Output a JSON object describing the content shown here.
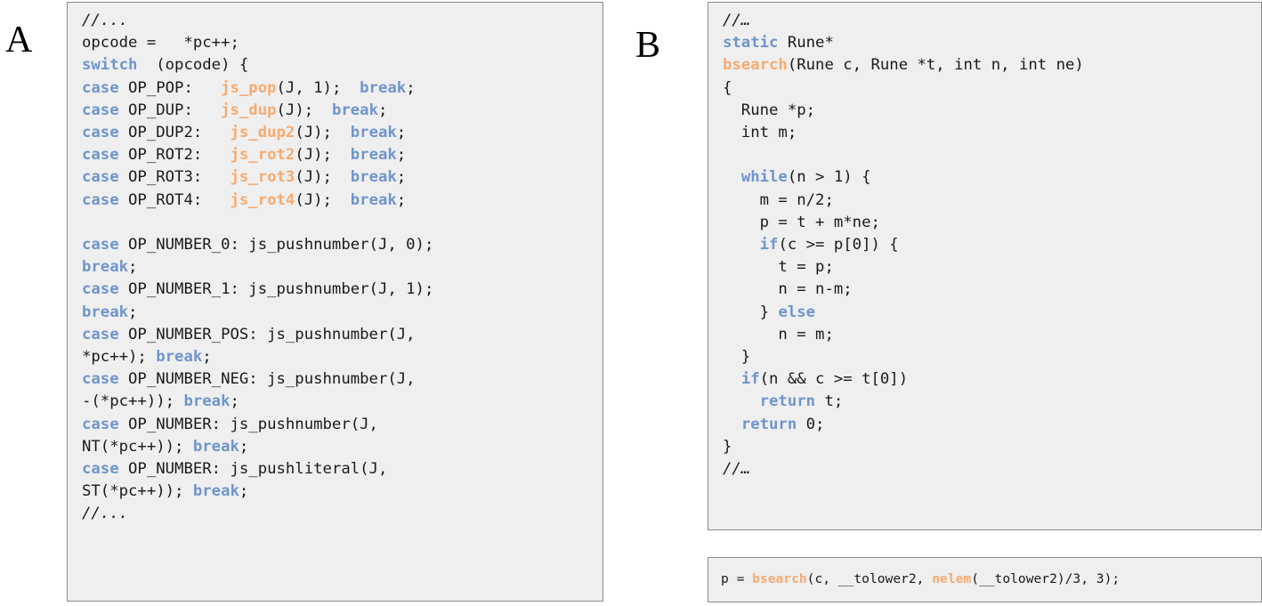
{
  "figure": {
    "background_color": "#ffffff",
    "panel_labels": [
      {
        "name": "A",
        "text": "A"
      },
      {
        "name": "B",
        "text": "B"
      }
    ]
  },
  "colors": {
    "keyword": "#6f95cd",
    "function": "#f7ab70",
    "plain": "#1a1a1a",
    "box_background": "#efefef",
    "box_border": "#8a8a8a",
    "page_background": "#ffffff"
  },
  "panel_a": {
    "label": "A",
    "language": "c",
    "code_text": "//...\nopcode =   *pc++;\nswitch  (opcode) {\ncase OP_POP:   js_pop(J, 1);  break;\ncase OP_DUP:   js_dup(J);  break;\ncase OP_DUP2:   js_dup2(J);  break;\ncase OP_ROT2:   js_rot2(J);  break;\ncase OP_ROT3:   js_rot3(J);  break;\ncase OP_ROT4:   js_rot4(J);  break;\n\ncase OP_NUMBER_0: js_pushnumber(J, 0);\nbreak;\ncase OP_NUMBER_1: js_pushnumber(J, 1);\nbreak;\ncase OP_NUMBER_POS: js_pushnumber(J,\n*pc++); break;\ncase OP_NUMBER_NEG: js_pushnumber(J,\n-(*pc++)); break;\ncase OP_NUMBER: js_pushnumber(J,\nNT(*pc++)); break;\ncase OP_NUMBER: js_pushliteral(J,\nST(*pc++)); break;\n//...",
    "lines": [
      [
        {
          "t": "//...",
          "c": "cm"
        }
      ],
      [
        {
          "t": "opcode =   *pc++;",
          "c": "pl"
        }
      ],
      [
        {
          "t": "switch",
          "c": "kw"
        },
        {
          "t": "  (opcode) {",
          "c": "pl"
        }
      ],
      [
        {
          "t": "case",
          "c": "kw"
        },
        {
          "t": " OP_POP:   ",
          "c": "pl"
        },
        {
          "t": "js_pop",
          "c": "fn"
        },
        {
          "t": "(J, 1);  ",
          "c": "pl"
        },
        {
          "t": "break",
          "c": "kw"
        },
        {
          "t": ";",
          "c": "pl"
        }
      ],
      [
        {
          "t": "case",
          "c": "kw"
        },
        {
          "t": " OP_DUP:   ",
          "c": "pl"
        },
        {
          "t": "js_dup",
          "c": "fn"
        },
        {
          "t": "(J);  ",
          "c": "pl"
        },
        {
          "t": "break",
          "c": "kw"
        },
        {
          "t": ";",
          "c": "pl"
        }
      ],
      [
        {
          "t": "case",
          "c": "kw"
        },
        {
          "t": " OP_DUP2:   ",
          "c": "pl"
        },
        {
          "t": "js_dup2",
          "c": "fn"
        },
        {
          "t": "(J);  ",
          "c": "pl"
        },
        {
          "t": "break",
          "c": "kw"
        },
        {
          "t": ";",
          "c": "pl"
        }
      ],
      [
        {
          "t": "case",
          "c": "kw"
        },
        {
          "t": " OP_ROT2:   ",
          "c": "pl"
        },
        {
          "t": "js_rot2",
          "c": "fn"
        },
        {
          "t": "(J);  ",
          "c": "pl"
        },
        {
          "t": "break",
          "c": "kw"
        },
        {
          "t": ";",
          "c": "pl"
        }
      ],
      [
        {
          "t": "case",
          "c": "kw"
        },
        {
          "t": " OP_ROT3:   ",
          "c": "pl"
        },
        {
          "t": "js_rot3",
          "c": "fn"
        },
        {
          "t": "(J);  ",
          "c": "pl"
        },
        {
          "t": "break",
          "c": "kw"
        },
        {
          "t": ";",
          "c": "pl"
        }
      ],
      [
        {
          "t": "case",
          "c": "kw"
        },
        {
          "t": " OP_ROT4:   ",
          "c": "pl"
        },
        {
          "t": "js_rot4",
          "c": "fn"
        },
        {
          "t": "(J);  ",
          "c": "pl"
        },
        {
          "t": "break",
          "c": "kw"
        },
        {
          "t": ";",
          "c": "pl"
        }
      ],
      [],
      [
        {
          "t": "case",
          "c": "kw"
        },
        {
          "t": " OP_NUMBER_0: js_pushnumber(J, 0);",
          "c": "pl"
        }
      ],
      [
        {
          "t": "break",
          "c": "kw"
        },
        {
          "t": ";",
          "c": "pl"
        }
      ],
      [
        {
          "t": "case",
          "c": "kw"
        },
        {
          "t": " OP_NUMBER_1: js_pushnumber(J, 1);",
          "c": "pl"
        }
      ],
      [
        {
          "t": "break",
          "c": "kw"
        },
        {
          "t": ";",
          "c": "pl"
        }
      ],
      [
        {
          "t": "case",
          "c": "kw"
        },
        {
          "t": " OP_NUMBER_POS: js_pushnumber(J,",
          "c": "pl"
        }
      ],
      [
        {
          "t": "*pc++); ",
          "c": "pl"
        },
        {
          "t": "break",
          "c": "kw"
        },
        {
          "t": ";",
          "c": "pl"
        }
      ],
      [
        {
          "t": "case",
          "c": "kw"
        },
        {
          "t": " OP_NUMBER_NEG: js_pushnumber(J,",
          "c": "pl"
        }
      ],
      [
        {
          "t": "-(*pc++)); ",
          "c": "pl"
        },
        {
          "t": "break",
          "c": "kw"
        },
        {
          "t": ";",
          "c": "pl"
        }
      ],
      [
        {
          "t": "case",
          "c": "kw"
        },
        {
          "t": " OP_NUMBER: js_pushnumber(J,",
          "c": "pl"
        }
      ],
      [
        {
          "t": "NT(*pc++)); ",
          "c": "pl"
        },
        {
          "t": "break",
          "c": "kw"
        },
        {
          "t": ";",
          "c": "pl"
        }
      ],
      [
        {
          "t": "case",
          "c": "kw"
        },
        {
          "t": " OP_NUMBER: js_pushliteral(J,",
          "c": "pl"
        }
      ],
      [
        {
          "t": "ST(*pc++)); ",
          "c": "pl"
        },
        {
          "t": "break",
          "c": "kw"
        },
        {
          "t": ";",
          "c": "pl"
        }
      ],
      [
        {
          "t": "//...",
          "c": "cm"
        }
      ]
    ]
  },
  "panel_b": {
    "label": "B",
    "language": "c",
    "code_text": "//…\nstatic Rune*\nbsearch(Rune c, Rune *t, int n, int ne)\n{\n  Rune *p;\n  int m;\n\n  while(n > 1) {\n    m = n/2;\n    p = t + m*ne;\n    if(c >= p[0]) {\n      t = p;\n      n = n-m;\n    } else\n      n = m;\n  }\n  if(n && c >= t[0])\n    return t;\n  return 0;\n}\n//…",
    "lines": [
      [
        {
          "t": "//…",
          "c": "cm"
        }
      ],
      [
        {
          "t": "static",
          "c": "kw"
        },
        {
          "t": " Rune*",
          "c": "pl"
        }
      ],
      [
        {
          "t": "bsearch",
          "c": "fn"
        },
        {
          "t": "(Rune c, Rune *t, int n, int ne)",
          "c": "pl"
        }
      ],
      [
        {
          "t": "{",
          "c": "pl"
        }
      ],
      [
        {
          "t": "  Rune *p;",
          "c": "pl"
        }
      ],
      [
        {
          "t": "  int m;",
          "c": "pl"
        }
      ],
      [],
      [
        {
          "t": "  ",
          "c": "pl"
        },
        {
          "t": "while",
          "c": "kw"
        },
        {
          "t": "(n > 1) {",
          "c": "pl"
        }
      ],
      [
        {
          "t": "    m = n/2;",
          "c": "pl"
        }
      ],
      [
        {
          "t": "    p = t + m*ne;",
          "c": "pl"
        }
      ],
      [
        {
          "t": "    ",
          "c": "pl"
        },
        {
          "t": "if",
          "c": "kw"
        },
        {
          "t": "(c >= p[0]) {",
          "c": "pl"
        }
      ],
      [
        {
          "t": "      t = p;",
          "c": "pl"
        }
      ],
      [
        {
          "t": "      n = n-m;",
          "c": "pl"
        }
      ],
      [
        {
          "t": "    } ",
          "c": "pl"
        },
        {
          "t": "else",
          "c": "kw"
        }
      ],
      [
        {
          "t": "      n = m;",
          "c": "pl"
        }
      ],
      [
        {
          "t": "  }",
          "c": "pl"
        }
      ],
      [
        {
          "t": "  ",
          "c": "pl"
        },
        {
          "t": "if",
          "c": "kw"
        },
        {
          "t": "(n && c >= t[0])",
          "c": "pl"
        }
      ],
      [
        {
          "t": "    ",
          "c": "pl"
        },
        {
          "t": "return",
          "c": "kw"
        },
        {
          "t": " t;",
          "c": "pl"
        }
      ],
      [
        {
          "t": "  ",
          "c": "pl"
        },
        {
          "t": "return",
          "c": "kw"
        },
        {
          "t": " 0;",
          "c": "pl"
        }
      ],
      [
        {
          "t": "}",
          "c": "pl"
        }
      ],
      [
        {
          "t": "//…",
          "c": "cm"
        }
      ]
    ],
    "call_site": {
      "code_text": "p = bsearch(c, __tolower2, nelem(__tolower2)/3, 3);",
      "lines": [
        [
          {
            "t": "p = ",
            "c": "pl"
          },
          {
            "t": "bsearch",
            "c": "fn"
          },
          {
            "t": "(c, __tolower2, ",
            "c": "pl"
          },
          {
            "t": "nelem",
            "c": "fn"
          },
          {
            "t": "(__tolower2)/3, 3);",
            "c": "pl"
          }
        ]
      ]
    }
  }
}
